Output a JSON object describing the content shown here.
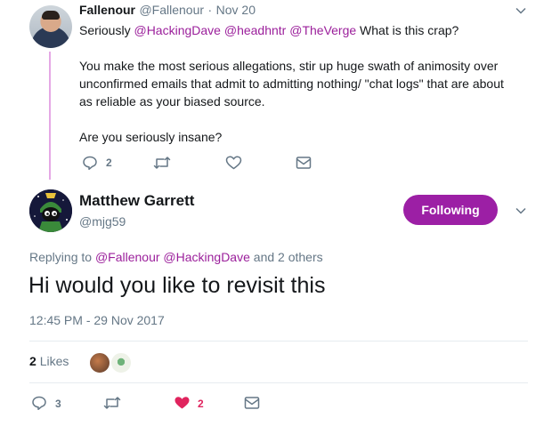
{
  "parent_tweet": {
    "name": "Fallenour",
    "handle": "@Fallenour",
    "separator": "·",
    "date": "Nov 20",
    "line1_prefix": "Seriously",
    "mention1": "@HackingDave",
    "mention2": "@headhntr",
    "mention3": "@TheVerge",
    "line1_suffix": "What is this crap?",
    "paragraph2_line1": "You make the most serious allegations, stir up huge swath of animosity over",
    "paragraph2_line2": "unconfirmed emails that admit to admitting nothing/ \"chat logs\" that are about",
    "paragraph2_line3": "as reliable as your biased source.",
    "paragraph3": "Are you seriously insane?",
    "reply_count": "2"
  },
  "main_tweet": {
    "name": "Matthew Garrett",
    "handle": "@mjg59",
    "follow_label": "Following",
    "replying_prefix": "Replying to",
    "replying_mention1": "@Fallenour",
    "replying_mention2": "@HackingDave",
    "replying_suffix": "and 2 others",
    "text": "Hi would you like to revisit this",
    "timestamp": "12:45 PM - 29 Nov 2017",
    "likes_number": "2",
    "likes_label": "Likes",
    "reply_count": "3",
    "like_count": "2"
  },
  "colors": {
    "accent": "#9c1fa5",
    "mention": "#9b1f9b",
    "muted": "#657786",
    "heart": "#e0245e",
    "thread_line": "#e5a8e5"
  },
  "icons": [
    "chevron-down-icon",
    "reply-icon",
    "retweet-icon",
    "heart-icon",
    "message-icon"
  ]
}
